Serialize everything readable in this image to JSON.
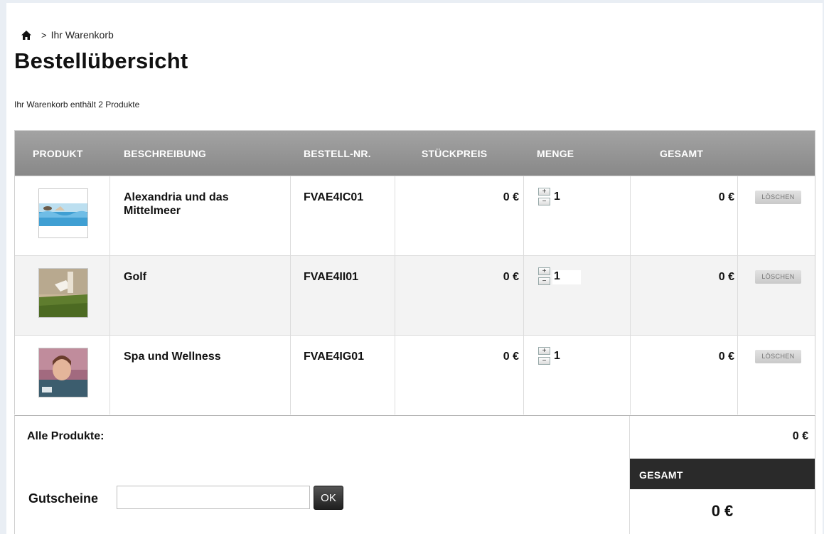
{
  "breadcrumb": {
    "home_icon": "home-icon",
    "separator": ">",
    "current": "Ihr Warenkorb"
  },
  "page_title": "Bestellübersicht",
  "cart_summary": "Ihr Warenkorb enthält 2 Produkte",
  "table": {
    "headers": {
      "produkt": "PRODUKT",
      "beschreibung": "BESCHREIBUNG",
      "bestellnr": "BESTELL-NR.",
      "stueckpreis": "STÜCKPREIS",
      "menge": "MENGE",
      "gesamt": "GESAMT"
    },
    "rows": [
      {
        "name": "Alexandria und das Mittelmeer",
        "sku": "FVAE4IC01",
        "price": "0 €",
        "qty": "1",
        "total": "0 €",
        "delete_label": "LÖSCHEN",
        "thumb_icon": "sea-photo-thumbnail"
      },
      {
        "name": "Golf",
        "sku": "FVAE4II01",
        "price": "0 €",
        "qty": "1",
        "total": "0 €",
        "delete_label": "LÖSCHEN",
        "thumb_icon": "golf-photo-thumbnail"
      },
      {
        "name": "Spa und Wellness",
        "sku": "FVAE4IG01",
        "price": "0 €",
        "qty": "1",
        "total": "0 €",
        "delete_label": "LÖSCHEN",
        "thumb_icon": "spa-photo-thumbnail"
      }
    ],
    "qty_plus": "+",
    "qty_minus": "−"
  },
  "all_products": {
    "label": "Alle Produkte:",
    "value": "0 €"
  },
  "coupon": {
    "label": "Gutscheine",
    "input_value": "",
    "button": "OK"
  },
  "grand_total": {
    "label": "GESAMT",
    "value": "0 €"
  },
  "colors": {
    "header_gradient_top": "#a3a3a3",
    "header_gradient_bottom": "#888888",
    "total_header_bg": "#2a2a2a",
    "alt_row_bg": "#f3f3f3"
  }
}
